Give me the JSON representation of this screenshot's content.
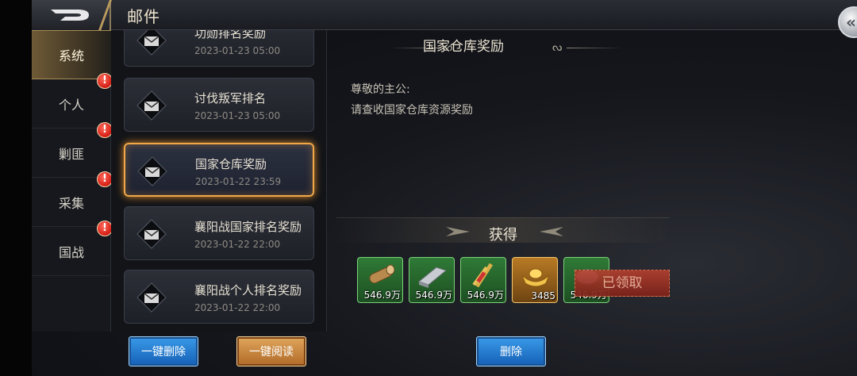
{
  "header": {
    "title": "邮件",
    "back_icon": "chevron-left-double-icon"
  },
  "tabs": [
    {
      "label": "系统",
      "active": true,
      "badge": ""
    },
    {
      "label": "个人",
      "active": false,
      "badge": "!"
    },
    {
      "label": "剿匪",
      "active": false,
      "badge": "!"
    },
    {
      "label": "采集",
      "active": false,
      "badge": "!"
    },
    {
      "label": "国战",
      "active": false,
      "badge": "!"
    }
  ],
  "mails": [
    {
      "subject": "功勋排名奖励",
      "date": "2023-01-23   05:00",
      "active": false
    },
    {
      "subject": "讨伐叛军排名",
      "date": "2023-01-23   05:00",
      "active": false
    },
    {
      "subject": "国家仓库奖励",
      "date": "2023-01-22   23:59",
      "active": true
    },
    {
      "subject": "襄阳战国家排名奖励",
      "date": "2023-01-22   22:00",
      "active": false
    },
    {
      "subject": "襄阳战个人排名奖励",
      "date": "2023-01-22   22:00",
      "active": false
    }
  ],
  "detail": {
    "title": "国家仓库奖励",
    "greeting": "尊敬的主公:",
    "body": "请查收国家仓库资源奖励",
    "reward_label": "获得",
    "items": [
      {
        "name": "wood-icon",
        "qty": "546.9万"
      },
      {
        "name": "iron-icon",
        "qty": "546.9万"
      },
      {
        "name": "grain-icon",
        "qty": "546.9万"
      },
      {
        "name": "gold-ingot-icon",
        "qty": "3485"
      },
      {
        "name": "silver-icon",
        "qty": "546.9万"
      }
    ],
    "claimed_label": "已领取"
  },
  "buttons": {
    "delete_all": "一键删除",
    "read_all": "一键阅读",
    "delete": "删除"
  },
  "colors": {
    "accent": "#f0a848",
    "badge": "#d41c14",
    "button_blue": "#1460b6",
    "button_gold": "#b06a28"
  }
}
